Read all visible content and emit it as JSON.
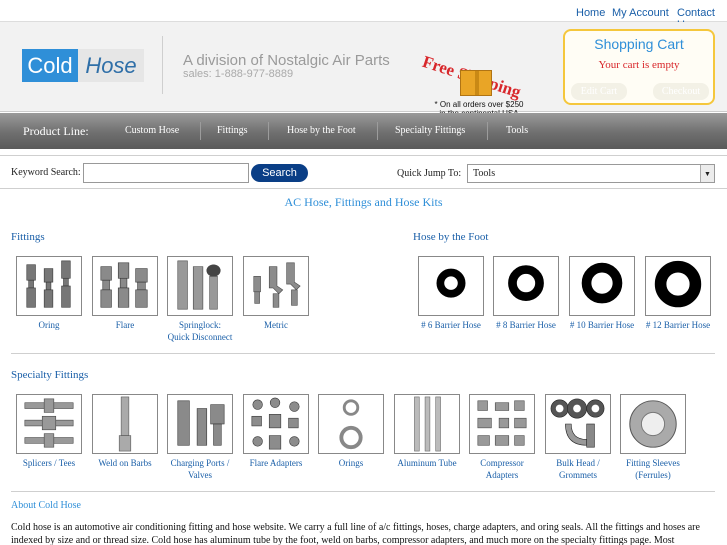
{
  "top_links": {
    "home": "Home",
    "account": "My Account",
    "contact": "Contact Us"
  },
  "logo": {
    "part1": "Cold",
    "part2": "Hose"
  },
  "header": {
    "division": "A division of Nostalgic Air Parts",
    "sales": "sales: 1-888-977-8889"
  },
  "promo": {
    "title": "Free Shipping",
    "note_line1": "* On all orders over $250",
    "note_line2": "in the continental USA"
  },
  "cart": {
    "title": "Shopping Cart",
    "status": "Your cart is empty",
    "edit": "Edit Cart",
    "checkout": "Checkout"
  },
  "nav": {
    "label": "Product Line:",
    "items": [
      "Custom Hose",
      "Fittings",
      "Hose by the Foot",
      "Specialty Fittings",
      "Tools"
    ]
  },
  "search": {
    "label": "Keyword Search:",
    "value": "",
    "button": "Search"
  },
  "quick_jump": {
    "label": "Quick Jump To:",
    "selected": "Tools"
  },
  "main_heading": "AC Hose, Fittings and Hose Kits",
  "fittings": {
    "title": "Fittings",
    "items": [
      {
        "line1": "Oring",
        "line2": ""
      },
      {
        "line1": "Flare",
        "line2": ""
      },
      {
        "line1": "Springlock:",
        "line2": "Quick Disconnect"
      },
      {
        "line1": "Metric",
        "line2": ""
      }
    ]
  },
  "hose_by_foot": {
    "title": "Hose by the Foot",
    "items": [
      {
        "line1": "# 6 Barrier Hose"
      },
      {
        "line1": "# 8 Barrier Hose"
      },
      {
        "line1": "# 10 Barrier Hose"
      },
      {
        "line1": "# 12 Barrier Hose"
      }
    ]
  },
  "specialty": {
    "title": "Specialty Fittings",
    "items": [
      {
        "line1": "Splicers / Tees",
        "line2": ""
      },
      {
        "line1": "Weld on Barbs",
        "line2": ""
      },
      {
        "line1": "Charging Ports /",
        "line2": "Valves"
      },
      {
        "line1": "Flare Adapters",
        "line2": ""
      },
      {
        "line1": "Orings",
        "line2": ""
      },
      {
        "line1": "Aluminum Tube",
        "line2": ""
      },
      {
        "line1": "Compressor",
        "line2": "Adapters"
      },
      {
        "line1": "Bulk Head /",
        "line2": "Grommets"
      },
      {
        "line1": "Fitting Sleeves",
        "line2": "(Ferrules)"
      }
    ]
  },
  "about": {
    "title": "About Cold Hose",
    "text": "Cold hose is an automotive air conditioning fitting and hose website. We carry a full line of a/c fittings, hoses, charge adapters, and oring seals. All the fittings and hoses are indexed by size and or thread size. Cold hose has aluminum tube by the foot, weld on barbs, compressor adapters, and much more on the specialty fittings page. Most"
  },
  "colors": {
    "accent": "#2f8fd8",
    "link": "#1a5fa8",
    "promo_red": "#d8262a",
    "search_btn": "#0a3e86",
    "cart_border": "#f5c73c"
  }
}
